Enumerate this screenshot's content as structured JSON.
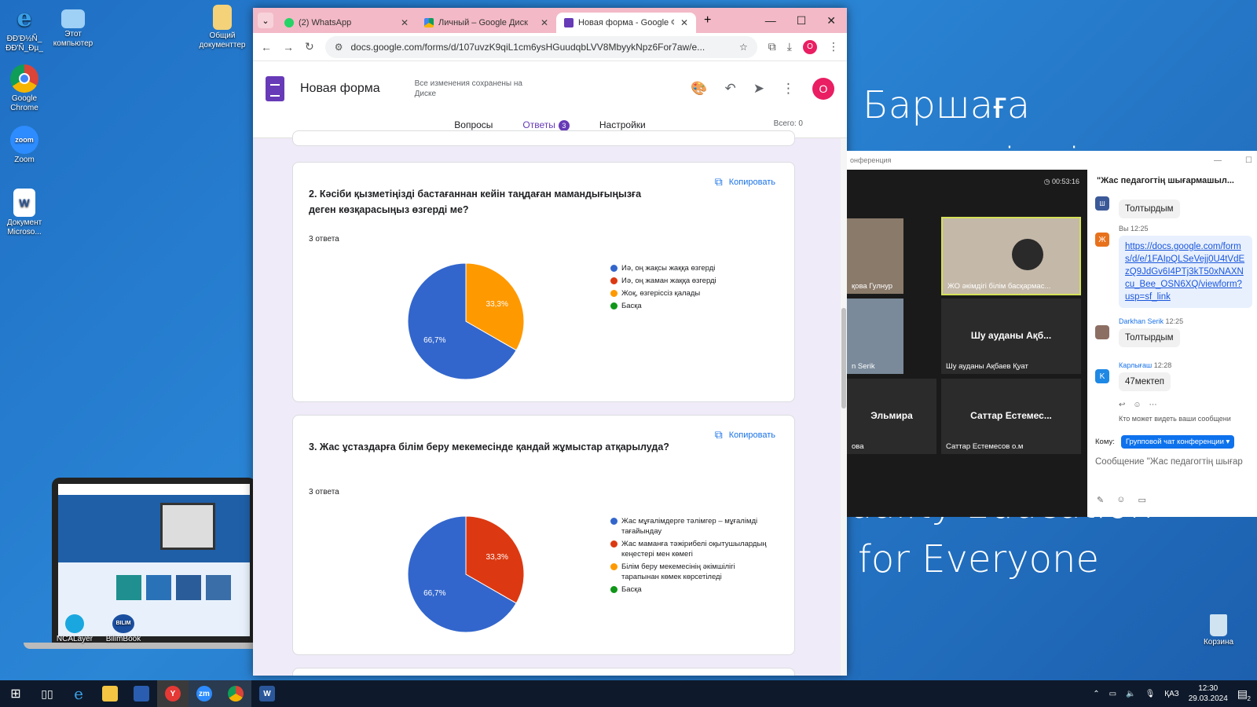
{
  "desktop": {
    "icons": [
      {
        "label": "ÐĐ'Ð½Ñ_ ÐĐ'Ñ_Ðµ_"
      },
      {
        "label": "Этот компьютер"
      },
      {
        "label": "Общий документтер"
      },
      {
        "label": "Google Chrome"
      },
      {
        "label": "Zoom"
      },
      {
        "label": "Документ Microso..."
      },
      {
        "label": "NCALayer"
      },
      {
        "label": "BilimBook"
      },
      {
        "label": "Корзина"
      }
    ],
    "wallpaper_top": "Баршаға қолжетімді",
    "wallpaper_bottom1": "uality Education",
    "wallpaper_bottom2": "for Everyone"
  },
  "browser": {
    "tabs": [
      {
        "label": "(2) WhatsApp"
      },
      {
        "label": "Личный – Google Диск"
      },
      {
        "label": "Новая форма - Google Фо"
      }
    ],
    "url": "docs.google.com/forms/d/107uvzK9qiL1cm6ysHGuudqbLVV8MbyykNpz6For7aw/e...",
    "profile_letter": "O"
  },
  "form": {
    "title": "Новая форма",
    "save_note": "Все изменения сохранены на Диске",
    "avatar_letter": "O",
    "tabs": {
      "questions": "Вопросы",
      "responses": "Ответы",
      "responses_count": "3",
      "settings": "Настройки"
    },
    "total": "Всего: 0",
    "copy_label": "Копировать",
    "cards": [
      {
        "question": "2. Кәсіби қызметіңізді бастағаннан кейін таңдаған мамандығыңызға деген көзқарасыңыз өзгерді ме?",
        "count": "3 ответа",
        "legend": [
          "Иә, оң жақсы жаққа өзгерді",
          "Иә, оң жаман жаққа өзгерді",
          "Жоқ, өзгеріссіз қалады",
          "Басқа"
        ],
        "slice_labels": [
          "66,7%",
          "33,3%"
        ]
      },
      {
        "question": "3. Жас ұстаздарға білім беру мекемесінде қандай жұмыстар атқарылуда?",
        "count": "3 ответа",
        "legend": [
          "Жас мұғалімдерге тәлімгер – мұғалімді тағайындау",
          "Жас маманға тәжірибелі оқытушылардың кеңестері мен көмегі",
          "Білім беру мекемесінің әкімшілігі тарапынан көмек көрсетіледі",
          "Басқа"
        ],
        "slice_labels": [
          "66,7%",
          "33,3%"
        ]
      }
    ]
  },
  "chart_data": [
    {
      "type": "pie",
      "categories": [
        "Иә, оң жақсы жаққа өзгерді",
        "Иә, оң жаман жаққа өзгерді",
        "Жоқ, өзгеріссіз қалады",
        "Басқа"
      ],
      "values": [
        66.7,
        0,
        33.3,
        0
      ],
      "colors": [
        "#3366cc",
        "#dc3912",
        "#ff9900",
        "#109618"
      ]
    },
    {
      "type": "pie",
      "categories": [
        "Жас мұғалімдерге тәлімгер – мұғалімді тағайындау",
        "Жас маманға тәжірибелі оқытушылардың кеңестері мен көмегі",
        "Білім беру мекемесінің әкімшілігі тарапынан көмек көрсетіледі",
        "Басқа"
      ],
      "values": [
        66.7,
        33.3,
        0,
        0
      ],
      "colors": [
        "#3366cc",
        "#dc3912",
        "#ff9900",
        "#109618"
      ]
    }
  ],
  "zoom": {
    "title": "онференция",
    "timer": "00:53:16",
    "tiles": [
      {
        "name": "қова Гулнур"
      },
      {
        "name": "ЖО әкімдігі білім басқармас..."
      },
      {
        "name": "n Serik"
      },
      {
        "big": "Шу ауданы Ақб...",
        "name": "Шу ауданы Ақбаев Қуат"
      },
      {
        "big": "Эльмира",
        "name": "ова"
      },
      {
        "big": "Саттар Естемес...",
        "name": "Саттар Естемесов о.м"
      }
    ],
    "chat": {
      "title": "\"Жас педагогтің шығармашыл...",
      "messages": [
        {
          "text": "Толтырдым"
        },
        {
          "meta": "Вы 12:25",
          "avatar": "Ж",
          "link": "https://docs.google.com/forms/d/e/1FAIpQLSeVejj0U4tVdEzQ9JdGv6I4PTj3kT50xNAXNcu_Bee_OSN6XQ/viewform?usp=sf_link"
        },
        {
          "sender": "Darkhan Serik",
          "time": "12:25",
          "text": "Толтырдым"
        },
        {
          "sender": "Карлығаш",
          "time": "12:28",
          "avatar": "K",
          "text": "47мектеп"
        }
      ],
      "who_sees": "Кто может видеть ваши сообщени",
      "to_label": "Кому:",
      "to_value": "Групповой чат конференции",
      "placeholder": "Сообщение \"Жас педагогтің шығар"
    }
  },
  "taskbar": {
    "lang": "ҚАЗ",
    "time": "12:30",
    "date": "29.03.2024",
    "notif": "2"
  }
}
